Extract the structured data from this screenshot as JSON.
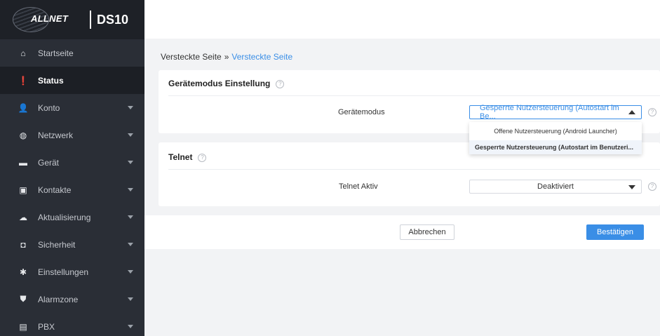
{
  "brand": {
    "logo_text": "ALLNET",
    "model": "DS10"
  },
  "sidebar": {
    "items": [
      {
        "label": "Startseite",
        "icon": "home-icon",
        "glyph": "⌂",
        "expandable": false,
        "active": false
      },
      {
        "label": "Status",
        "icon": "alert-circle-icon",
        "glyph": "❗",
        "expandable": false,
        "active": true
      },
      {
        "label": "Konto",
        "icon": "user-icon",
        "glyph": "👤",
        "expandable": true,
        "active": false
      },
      {
        "label": "Netzwerk",
        "icon": "globe-icon",
        "glyph": "◍",
        "expandable": true,
        "active": false
      },
      {
        "label": "Gerät",
        "icon": "monitor-icon",
        "glyph": "▬",
        "expandable": true,
        "active": false
      },
      {
        "label": "Kontakte",
        "icon": "contacts-icon",
        "glyph": "▣",
        "expandable": true,
        "active": false
      },
      {
        "label": "Aktualisierung",
        "icon": "cloud-upload-icon",
        "glyph": "☁",
        "expandable": true,
        "active": false
      },
      {
        "label": "Sicherheit",
        "icon": "shield-icon",
        "glyph": "◘",
        "expandable": true,
        "active": false
      },
      {
        "label": "Einstellungen",
        "icon": "gear-icon",
        "glyph": "✱",
        "expandable": true,
        "active": false
      },
      {
        "label": "Alarmzone",
        "icon": "alarm-shield-icon",
        "glyph": "⛊",
        "expandable": true,
        "active": false
      },
      {
        "label": "PBX",
        "icon": "pbx-icon",
        "glyph": "▤",
        "expandable": true,
        "active": false
      }
    ]
  },
  "breadcrumb": {
    "parent": "Versteckte Seite",
    "separator": "»",
    "current": "Versteckte Seite"
  },
  "device_mode_card": {
    "title": "Gerätemodus Einstellung",
    "field_label": "Gerätemodus",
    "selected_value": "Gesperrte Nutzersteuerung (Autostart im Be...",
    "options": [
      "Offene Nutzersteuerung (Android Launcher)",
      "Gesperrte Nutzersteuerung (Autostart im Benutzeri..."
    ]
  },
  "telnet_card": {
    "title": "Telnet",
    "field_label": "Telnet Aktiv",
    "selected_value": "Deaktiviert"
  },
  "footer": {
    "cancel_label": "Abbrechen",
    "confirm_label": "Bestätigen"
  },
  "help_glyph": "?",
  "colors": {
    "accent": "#3a8ee6",
    "sidebar_bg": "#2a2e36",
    "sidebar_active": "#1c1f25"
  }
}
